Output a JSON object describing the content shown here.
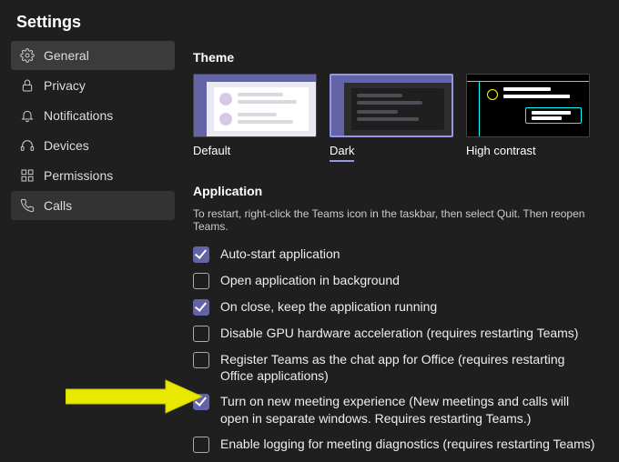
{
  "header": {
    "title": "Settings"
  },
  "sidebar": {
    "items": [
      {
        "label": "General"
      },
      {
        "label": "Privacy"
      },
      {
        "label": "Notifications"
      },
      {
        "label": "Devices"
      },
      {
        "label": "Permissions"
      },
      {
        "label": "Calls"
      }
    ]
  },
  "theme": {
    "title": "Theme",
    "options": [
      {
        "label": "Default"
      },
      {
        "label": "Dark"
      },
      {
        "label": "High contrast"
      }
    ],
    "selected": "Dark"
  },
  "application": {
    "title": "Application",
    "description": "To restart, right-click the Teams icon in the taskbar, then select Quit. Then reopen Teams.",
    "options": [
      {
        "label": "Auto-start application",
        "checked": true
      },
      {
        "label": "Open application in background",
        "checked": false
      },
      {
        "label": "On close, keep the application running",
        "checked": true
      },
      {
        "label": "Disable GPU hardware acceleration (requires restarting Teams)",
        "checked": false
      },
      {
        "label": "Register Teams as the chat app for Office (requires restarting Office applications)",
        "checked": false
      },
      {
        "label": "Turn on new meeting experience (New meetings and calls will open in separate windows. Requires restarting Teams.)",
        "checked": true
      },
      {
        "label": "Enable logging for meeting diagnostics (requires restarting Teams)",
        "checked": false
      }
    ]
  }
}
